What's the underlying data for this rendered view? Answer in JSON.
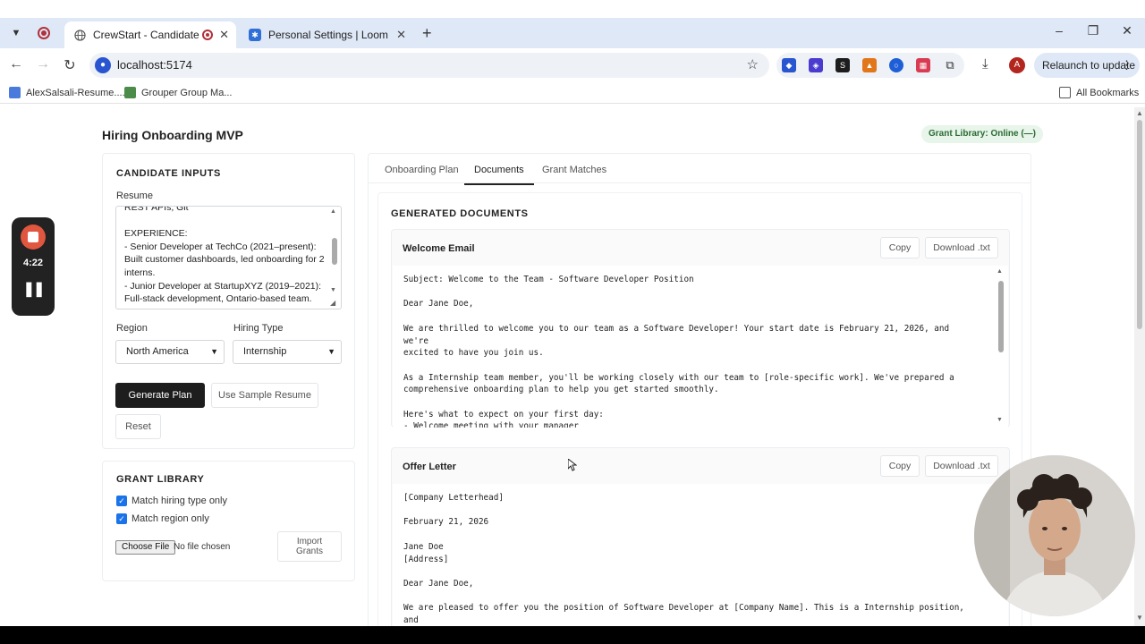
{
  "browser": {
    "tabs": [
      {
        "title": "CrewStart - Candidate Onb",
        "active": true
      },
      {
        "title": "Personal Settings | Loom",
        "active": false
      }
    ],
    "url": "localhost:5174",
    "relaunch_label": "Relaunch to update",
    "avatar_letter": "A",
    "bookmarks": [
      {
        "label": "AlexSalsali-Resume...."
      },
      {
        "label": "Grouper Group Ma..."
      }
    ],
    "all_bookmarks_label": "All Bookmarks"
  },
  "header": {
    "title": "Hiring Onboarding MVP",
    "grant_status": "Grant Library: Online (—)"
  },
  "candidate_inputs": {
    "heading": "CANDIDATE INPUTS",
    "resume_label": "Resume",
    "resume_text": "REST APIs, Git\n\nEXPERIENCE:\n- Senior Developer at TechCo (2021–present): Built customer dashboards, led onboarding for 2 interns.\n- Junior Developer at StartupXYZ (2019–2021): Full-stack development, Ontario-based team.",
    "region_label": "Region",
    "region_value": "North America",
    "hiring_type_label": "Hiring Type",
    "hiring_type_value": "Internship",
    "generate_label": "Generate Plan",
    "sample_label": "Use Sample Resume",
    "reset_label": "Reset"
  },
  "grant_library": {
    "heading": "GRANT LIBRARY",
    "match_hiring_type": "Match hiring type only",
    "match_region": "Match region only",
    "match_hiring_type_checked": true,
    "match_region_checked": true,
    "choose_file_label": "Choose File",
    "no_file_label": "No file chosen",
    "import_label": "Import\nGrants"
  },
  "main": {
    "tabs": [
      "Onboarding Plan",
      "Documents",
      "Grant Matches"
    ],
    "active_tab": "Documents",
    "docs_heading": "GENERATED DOCUMENTS",
    "documents": [
      {
        "title": "Welcome Email",
        "copy_label": "Copy",
        "download_label": "Download .txt",
        "body": "Subject: Welcome to the Team - Software Developer Position\n\nDear Jane Doe,\n\nWe are thrilled to welcome you to our team as a Software Developer! Your start date is February 21, 2026, and we're\nexcited to have you join us.\n\nAs a Internship team member, you'll be working closely with our team to [role-specific work]. We've prepared a\ncomprehensive onboarding plan to help you get started smoothly.\n\nHere's what to expect on your first day:\n- Welcome meeting with your manager\n- IT setup and access provisioning"
      },
      {
        "title": "Offer Letter",
        "copy_label": "Copy",
        "download_label": "Download .txt",
        "body": "[Company Letterhead]\n\nFebruary 21, 2026\n\nJane Doe\n[Address]\n\nDear Jane Doe,\n\nWe are pleased to offer you the position of Software Developer at [Company Name]. This is a Internship position, and\nwe believe your skills and experience will be a great addition to our team."
      }
    ]
  },
  "recorder": {
    "elapsed": "4:22"
  },
  "colors": {
    "accent": "#1a73e8",
    "primary_button": "#1d1d1d",
    "status_bg": "#e8f5ea",
    "status_text": "#2b6b34",
    "record": "#e0563f"
  }
}
